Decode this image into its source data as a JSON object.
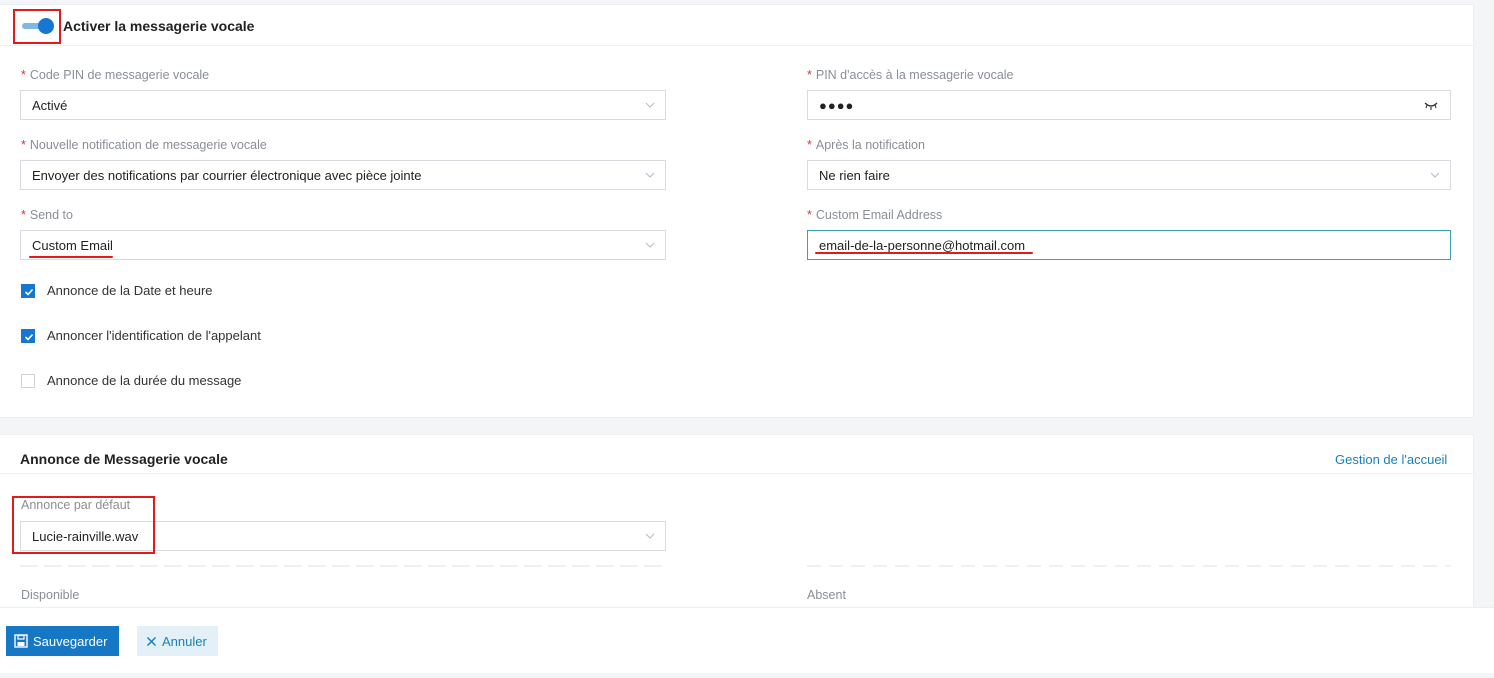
{
  "voicemail": {
    "toggle_title": "Activer la messagerie vocale",
    "enabled": true,
    "fields": {
      "pin_code": {
        "label": "Code PIN de messagerie vocale",
        "value": "Activé",
        "required": "*"
      },
      "pin_access": {
        "label": "PIN d'accès à la messagerie vocale",
        "value": "●●●●",
        "required": "*"
      },
      "new_notification": {
        "label": "Nouvelle notification de messagerie vocale",
        "value": "Envoyer des notifications par courrier électronique avec pièce jointe",
        "required": "*"
      },
      "after_notification": {
        "label": "Après la notification",
        "value": "Ne rien faire",
        "required": "*"
      },
      "send_to": {
        "label": "Send to",
        "value": "Custom Email",
        "required": "*"
      },
      "custom_email": {
        "label": "Custom Email Address",
        "value": "email-de-la-personne@hotmail.com",
        "required": "*"
      }
    },
    "checkboxes": [
      {
        "label": "Annonce de la Date et heure",
        "checked": true
      },
      {
        "label": "Annoncer l'identification de l'appelant",
        "checked": true
      },
      {
        "label": "Annonce de la durée du message",
        "checked": false
      }
    ]
  },
  "greeting": {
    "title": "Annonce de Messagerie vocale",
    "manage_link": "Gestion de l'accueil",
    "default_label": "Annonce par défaut",
    "default_value": "Lucie-rainville.wav",
    "available_label": "Disponible",
    "absent_label": "Absent"
  },
  "footer": {
    "save_label": "Sauvegarder",
    "cancel_label": "Annuler"
  },
  "colors": {
    "accent": "#1677d2",
    "annotation_red": "#e11b1b",
    "link": "#1b7fb8"
  },
  "icons": {
    "toggle": "toggle-switch-icon",
    "chevron": "chevron-down-icon",
    "eye": "eye-closed-icon",
    "check": "checkmark-icon",
    "save": "floppy-disk-icon",
    "cancel": "close-icon"
  }
}
